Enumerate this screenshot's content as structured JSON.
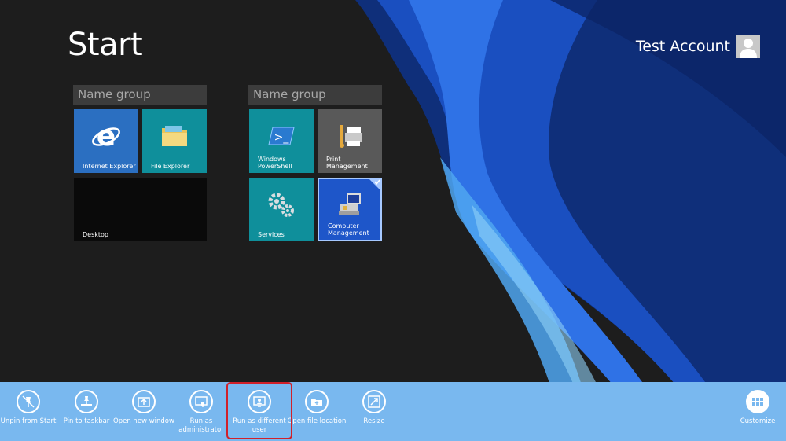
{
  "start": {
    "title": "Start"
  },
  "account": {
    "name": "Test Account"
  },
  "groups": [
    {
      "name": "Name group"
    },
    {
      "name": "Name group"
    }
  ],
  "tiles": {
    "internet_explorer": "Internet Explorer",
    "file_explorer": "File Explorer",
    "desktop": "Desktop",
    "powershell": "Windows PowerShell",
    "print_management": "Print Management",
    "services": "Services",
    "computer_management": "Computer Management"
  },
  "appbar": {
    "unpin": "Unpin from Start",
    "pin_taskbar": "Pin to taskbar",
    "open_new_window": "Open new window",
    "run_as_admin": "Run as administrator",
    "run_as_different_user": "Run as different user",
    "open_file_location": "Open file location",
    "resize": "Resize",
    "customize": "Customize"
  },
  "colors": {
    "background": "#1d1d1d",
    "appbar": "#79b8ef",
    "tile_blue": "#2b6fc1",
    "tile_teal": "#0f8f9b",
    "tile_gray": "#595959",
    "tile_selected": "#1e56c9",
    "highlight": "#d0202a"
  },
  "icons": [
    "unpin-icon",
    "pin-taskbar-icon",
    "new-window-icon",
    "admin-shield-icon",
    "different-user-icon",
    "file-location-icon",
    "resize-icon",
    "customize-icon"
  ]
}
